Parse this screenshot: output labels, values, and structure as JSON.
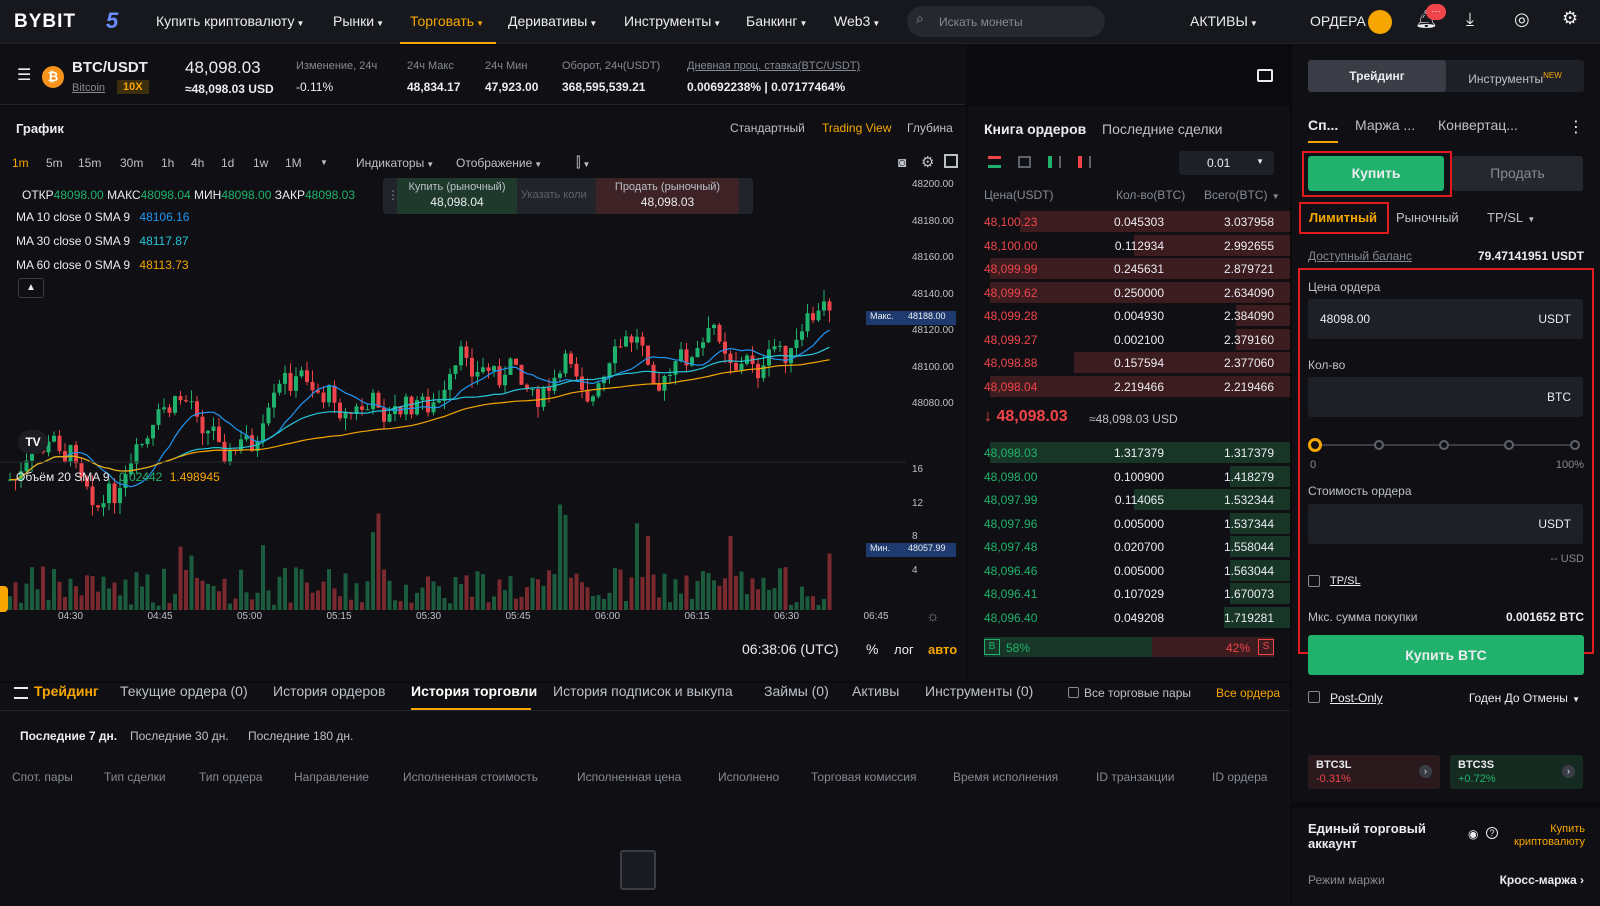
{
  "nav": {
    "logo": "BYBIT",
    "badge": "5",
    "items": [
      "Купить криптовалюту",
      "Рынки",
      "Торговать",
      "Деривативы",
      "Инструменты",
      "Банкинг",
      "Web3"
    ],
    "active": "Торговать",
    "search_placeholder": "Искать монеты",
    "assets": "АКТИВЫ",
    "orders": "ОРДЕРА",
    "notif_badge": "···"
  },
  "ticker": {
    "pair": "BTC/USDT",
    "name": "Bitcoin",
    "leverage": "10X",
    "price": "48,098.03",
    "price_usd": "≈48,098.03 USD",
    "change_label": "Изменение, 24ч",
    "change": "-0.11%",
    "high_label": "24ч Макс",
    "high": "48,834.17",
    "low_label": "24ч Мин",
    "low": "47,923.00",
    "turnover_label": "Оборот, 24ч(USDT)",
    "turnover": "368,595,539.21",
    "rate_label": "Дневная проц. ставка(BTC/USDT)",
    "rate": "0.00692238% | 0.07177464%"
  },
  "chart": {
    "title": "График",
    "views": [
      "Стандартный",
      "Trading View",
      "Глубина"
    ],
    "active_view": "Trading View",
    "intervals": [
      "1m",
      "5m",
      "15m",
      "30m",
      "1h",
      "4h",
      "1d",
      "1w",
      "1M"
    ],
    "indicators": "Индикаторы",
    "display": "Отображение",
    "ohlc": {
      "o_label": "ОТКР",
      "o": "48098.00",
      "h_label": "МАКС",
      "h": "48098.04",
      "l_label": "МИН",
      "l": "48098.00",
      "c_label": "ЗАКР",
      "c": "48098.03"
    },
    "ma": [
      {
        "label": "MA 10 close 0 SMA 9",
        "value": "48106.16",
        "color": "#2196f3"
      },
      {
        "label": "MA 30 close 0 SMA 9",
        "value": "48117.87",
        "color": "#26c6da"
      },
      {
        "label": "MA 60 close 0 SMA 9",
        "value": "48113.73",
        "color": "#f7a600"
      }
    ],
    "buy_market": "Купить (рыночный)",
    "buy_price": "48,098.04",
    "qty_placeholder": "Указать коли",
    "sell_market": "Продать (рыночный)",
    "sell_price": "48,098.03",
    "price_axis": [
      "48200.00",
      "48180.00",
      "48160.00",
      "48140.00",
      "48120.00",
      "48100.00",
      "48080.00"
    ],
    "max_label": "Макс.",
    "max_value": "48188.00",
    "min_label": "Мин.",
    "min_value": "48057.99",
    "volume_label": "Объём 20 SMA 9",
    "volume_v1": "0.02442",
    "volume_v2": "1.498945",
    "vol_axis": [
      "16",
      "12",
      "8",
      "4"
    ],
    "time_axis": [
      "04:30",
      "04:45",
      "05:00",
      "05:15",
      "05:30",
      "05:45",
      "06:00",
      "06:15",
      "06:30",
      "06:45"
    ],
    "clock": "06:38:06 (UTC)",
    "pct": "%",
    "log": "лог",
    "auto": "авто"
  },
  "orderbook": {
    "tab1": "Книга ордеров",
    "tab2": "Последние сделки",
    "precision": "0.01",
    "col_price": "Цена(USDT)",
    "col_qty": "Кол-во(BTC)",
    "col_total": "Всего(BTC)",
    "asks": [
      [
        "48,100.23",
        "0.045303",
        "3.037958",
        0.9
      ],
      [
        "48,100.00",
        "0.112934",
        "2.992655",
        0.52
      ],
      [
        "48,099.99",
        "0.245631",
        "2.879721",
        1.0
      ],
      [
        "48,099.62",
        "0.250000",
        "2.634090",
        1.0
      ],
      [
        "48,099.28",
        "0.004930",
        "2.384090",
        0.18
      ],
      [
        "48,099.27",
        "0.002100",
        "2.379160",
        0.18
      ],
      [
        "48,098.88",
        "0.157594",
        "2.377060",
        0.72
      ],
      [
        "48,098.04",
        "2.219466",
        "2.219466",
        1.0
      ]
    ],
    "last": "48,098.03",
    "last_usd": "≈48,098.03 USD",
    "bids": [
      [
        "48,098.03",
        "1.317379",
        "1.317379",
        1.0
      ],
      [
        "48,098.00",
        "0.100900",
        "1.418279",
        0.2
      ],
      [
        "48,097.99",
        "0.114065",
        "1.532344",
        0.52
      ],
      [
        "48,097.96",
        "0.005000",
        "1.537344",
        0.2
      ],
      [
        "48,097.48",
        "0.020700",
        "1.558044",
        0.2
      ],
      [
        "48,096.46",
        "0.005000",
        "1.563044",
        0.2
      ],
      [
        "48,096.41",
        "0.107029",
        "1.670073",
        0.2
      ],
      [
        "48,096.40",
        "0.049208",
        "1.719281",
        0.22
      ]
    ],
    "buy_label": "B",
    "buy_pct": "58%",
    "sell_label": "S",
    "sell_pct": "42%",
    "buy_ratio": 0.58
  },
  "trade": {
    "tab_trading": "Трейдинг",
    "tab_tools": "Инструменты",
    "new": "NEW",
    "modes": [
      "Сп...",
      "Маржа ...",
      "Конвертац..."
    ],
    "buy": "Купить",
    "sell": "Продать",
    "order_types": [
      "Лимитный",
      "Рыночный",
      "TP/SL"
    ],
    "balance_label": "Доступный баланс",
    "balance": "79.47141951 USDT",
    "price_label": "Цена ордера",
    "price_value": "48098.00",
    "price_unit": "USDT",
    "qty_label": "Кол-во",
    "qty_unit": "BTC",
    "slider_min": "0",
    "slider_max": "100%",
    "slider_level": 0,
    "cost_label": "Стоимость ордера",
    "cost_unit": "USDT",
    "cost_usd": "-- USD",
    "tpsl": "TP/SL",
    "max_buy_label": "Мкс. сумма покупки",
    "max_buy": "0.001652 BTC",
    "buy_btc": "Купить BTC",
    "post_only": "Post-Only",
    "tif": "Годен До Отмены",
    "tokens": [
      {
        "name": "BTC3L",
        "change": "-0.31%"
      },
      {
        "name": "BTC3S",
        "change": "+0.72%"
      }
    ],
    "account_title": "Единый торговый аккаунт",
    "buy_crypto": "Купить криптовалюту",
    "margin_mode_label": "Режим маржи",
    "margin_mode": "Кросс-маржа"
  },
  "bottom": {
    "tabs": [
      "Трейдинг",
      "Текущие ордера (0)",
      "История ордеров",
      "История торговли",
      "История подписок и выкупа",
      "Займы (0)",
      "Активы",
      "Инструменты (0)"
    ],
    "active": "История торговли",
    "all_pairs": "Все торговые пары",
    "all_orders": "Все ордера",
    "periods": [
      "Последние 7 дн.",
      "Последние 30 дн.",
      "Последние 180 дн."
    ],
    "columns": [
      "Спот. пары",
      "Тип сделки",
      "Тип ордера",
      "Направление",
      "Исполненная стоимость",
      "Исполненная цена",
      "Исполнено",
      "Торговая комиссия",
      "Время исполнения",
      "ID транзакции",
      "ID ордера"
    ]
  },
  "colors": {
    "green": "#20b26c",
    "red": "#ef454a",
    "accent": "#f7a600",
    "highlight": "#e01b22"
  }
}
